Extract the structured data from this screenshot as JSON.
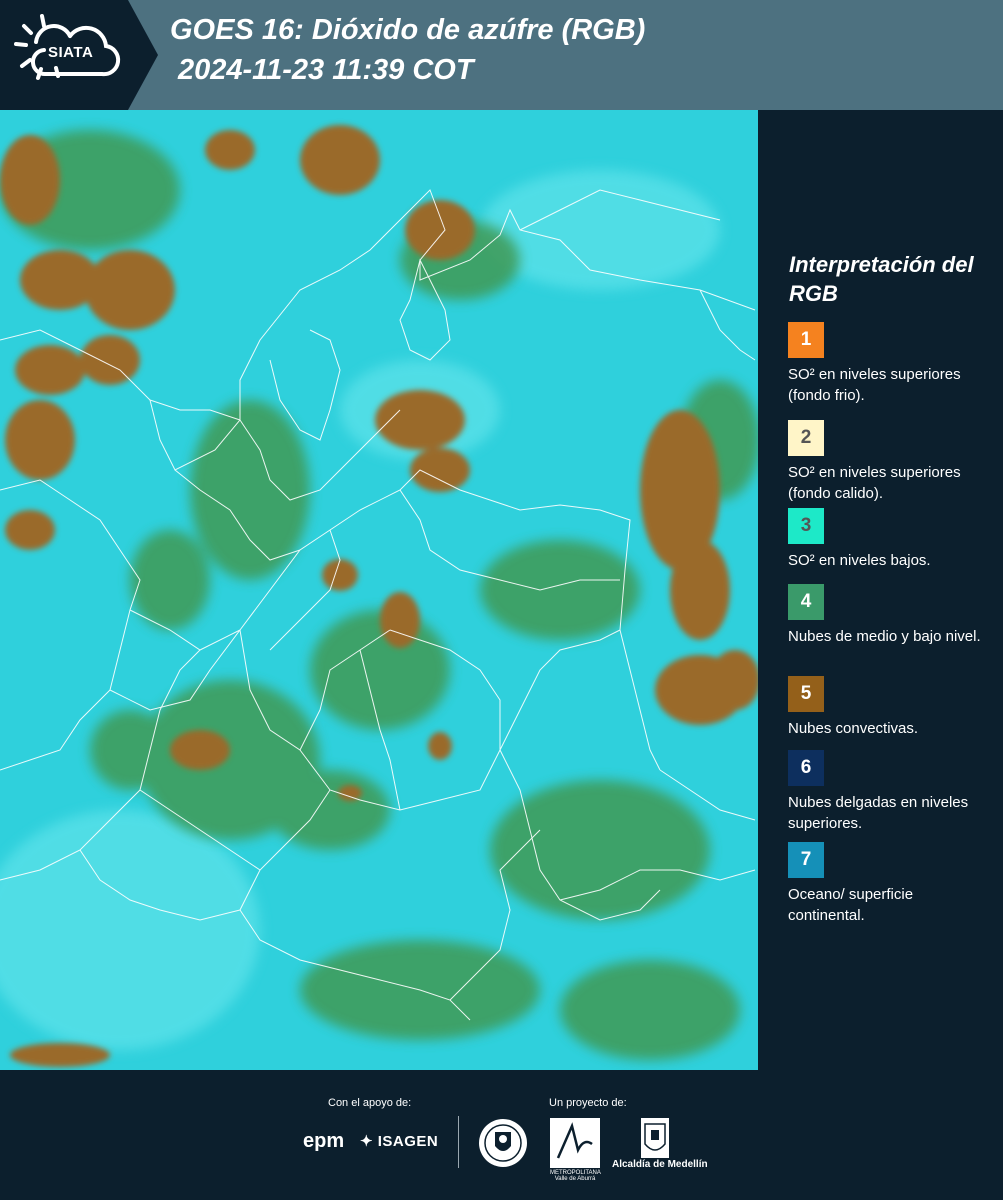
{
  "header": {
    "logo_text": "SIATA",
    "title_line1": "GOES 16: Dióxido de azúfre (RGB)",
    "title_line2": "2024-11-23 11:39 COT"
  },
  "legend": {
    "title": "Interpretación del RGB",
    "items": [
      {
        "number": "1",
        "color": "#f5821f",
        "text_color": "#ffffff",
        "label": "SO² en niveles superiores (fondo frio)."
      },
      {
        "number": "2",
        "color": "#fff5c8",
        "text_color": "#555555",
        "label": "SO² en niveles superiores (fondo calido)."
      },
      {
        "number": "3",
        "color": "#1de9c8",
        "text_color": "#555555",
        "label": "SO² en niveles bajos."
      },
      {
        "number": "4",
        "color": "#3a9a6a",
        "text_color": "#ffffff",
        "label": "Nubes de medio y bajo nivel."
      },
      {
        "number": "5",
        "color": "#94601a",
        "text_color": "#ffffff",
        "label": "Nubes convectivas."
      },
      {
        "number": "6",
        "color": "#0d2f5e",
        "text_color": "#ffffff",
        "label": "Nubes delgadas en niveles superiores."
      },
      {
        "number": "7",
        "color": "#1590b8",
        "text_color": "#ffffff",
        "label": "Oceano/ superficie continental."
      }
    ]
  },
  "footer": {
    "apoyo_label": "Con el apoyo de:",
    "proyecto_label": "Un proyecto de:",
    "epm": "epm",
    "isagen": "ISAGEN",
    "area_text": "METROPOLITANA Valle de Aburrá",
    "alcaldia": "Alcaldía de Medellín"
  },
  "colors": {
    "background": "#0c1f2d",
    "header_band": "#4d7180",
    "map_cyan": "#2fd0dc",
    "map_green": "#3f9a55",
    "map_brown": "#9a6a2a",
    "boundary": "#ffffff"
  }
}
